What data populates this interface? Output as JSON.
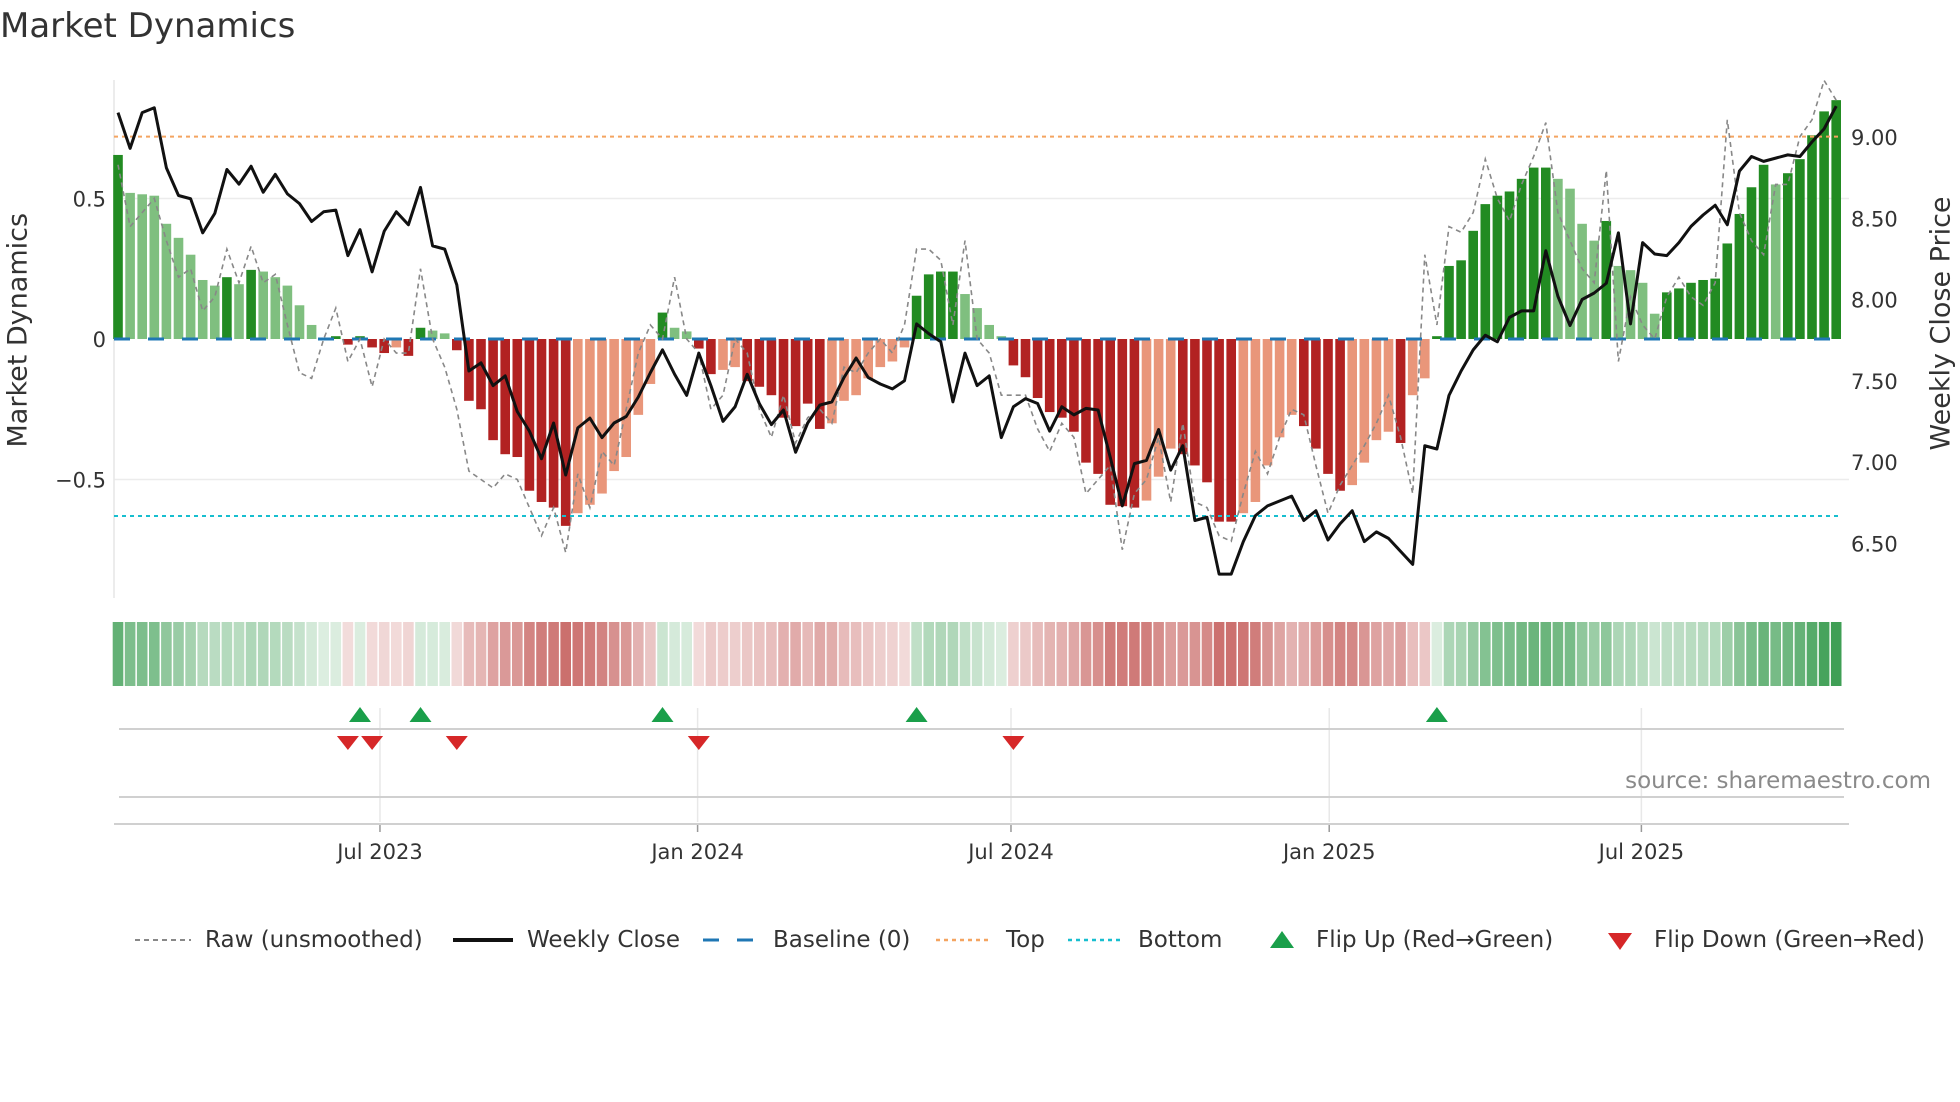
{
  "title": "Market Dynamics",
  "source": "source: sharemaestro.com",
  "chart_data": {
    "type": "bar",
    "title": "Market Dynamics",
    "ylabel": "Market Dynamics",
    "y2label": "Weekly Close Price",
    "ylim": [
      -0.92,
      0.92
    ],
    "y2lim": [
      6.12,
      9.38
    ],
    "yticks": [
      {
        "v": 0.5,
        "label": "0.5"
      },
      {
        "v": 0,
        "label": "0"
      },
      {
        "v": -0.5,
        "label": "−0.5"
      }
    ],
    "y2ticks": [
      {
        "v": 9.0,
        "label": "9.00"
      },
      {
        "v": 8.5,
        "label": "8.50"
      },
      {
        "v": 8.0,
        "label": "8.00"
      },
      {
        "v": 7.5,
        "label": "7.50"
      },
      {
        "v": 7.0,
        "label": "7.00"
      },
      {
        "v": 6.5,
        "label": "6.50"
      }
    ],
    "xticks": [
      {
        "week": 21.65,
        "label": "Jul 2023"
      },
      {
        "week": 47.9,
        "label": "Jan 2024"
      },
      {
        "week": 73.8,
        "label": "Jul 2024"
      },
      {
        "week": 100.1,
        "label": "Jan 2025"
      },
      {
        "week": 125.9,
        "label": "Jul 2025"
      }
    ],
    "grid": true,
    "legend_placement": "bottom",
    "top_level": 0.72,
    "bottom_level": -0.63,
    "baseline": 0,
    "colors": {
      "dark_green": "#228b22",
      "light_green": "#7fbf7f",
      "dark_red": "#b22222",
      "light_red": "#e9967a",
      "raw": "#888888",
      "close": "#111111",
      "baseline": "#1f77b4",
      "top": "#f4a460",
      "bottom": "#17becf",
      "flip_up": "#1a9f4a",
      "flip_down": "#d62728",
      "heat_green": "#3f9f55",
      "heat_red": "#c0504d"
    },
    "momentum": [
      0.655,
      0.52,
      0.515,
      0.51,
      0.41,
      0.36,
      0.3,
      0.21,
      0.19,
      0.22,
      0.195,
      0.246,
      0.24,
      0.22,
      0.19,
      0.12,
      0.05,
      0.005,
      0.01,
      -0.02,
      0.01,
      -0.03,
      -0.05,
      -0.03,
      -0.06,
      0.04,
      0.03,
      0.02,
      -0.04,
      -0.22,
      -0.25,
      -0.36,
      -0.41,
      -0.42,
      -0.54,
      -0.58,
      -0.6,
      -0.665,
      -0.62,
      -0.59,
      -0.55,
      -0.47,
      -0.42,
      -0.27,
      -0.16,
      0.094,
      0.04,
      0.027,
      -0.034,
      -0.125,
      -0.11,
      -0.1,
      -0.15,
      -0.17,
      -0.2,
      -0.28,
      -0.31,
      -0.23,
      -0.32,
      -0.3,
      -0.22,
      -0.2,
      -0.14,
      -0.1,
      -0.08,
      -0.03,
      0.154,
      0.23,
      0.24,
      0.24,
      0.16,
      0.11,
      0.05,
      0.01,
      -0.094,
      -0.136,
      -0.21,
      -0.26,
      -0.28,
      -0.33,
      -0.44,
      -0.48,
      -0.59,
      -0.595,
      -0.6,
      -0.575,
      -0.49,
      -0.39,
      -0.41,
      -0.45,
      -0.51,
      -0.65,
      -0.65,
      -0.62,
      -0.58,
      -0.45,
      -0.35,
      -0.27,
      -0.31,
      -0.39,
      -0.48,
      -0.54,
      -0.52,
      -0.44,
      -0.36,
      -0.33,
      -0.37,
      -0.2,
      -0.14,
      0.01,
      0.26,
      0.28,
      0.385,
      0.48,
      0.51,
      0.525,
      0.57,
      0.61,
      0.61,
      0.57,
      0.535,
      0.41,
      0.35,
      0.42,
      0.26,
      0.245,
      0.2,
      0.09,
      0.166,
      0.18,
      0.2,
      0.21,
      0.215,
      0.34,
      0.445,
      0.54,
      0.62,
      0.55,
      0.59,
      0.64,
      0.725,
      0.81,
      0.85
    ],
    "shade": "DLLLLLLLLDLDLLLLLLDDDDDLDDLLDDDDDDDDDDLLLLLLLDLLDDLLDDDDDDDLLLLLLLDDDDLLLLDDDDDDDDDDDLLLDDDDDLLLLLDDDDLLLLDLLDDDDDDDDDDLLLLDLLLLDDDDDDDDDLDDDDD",
    "raw": [
      0.62,
      0.4,
      0.45,
      0.5,
      0.35,
      0.22,
      0.25,
      0.1,
      0.15,
      0.32,
      0.2,
      0.33,
      0.2,
      0.23,
      0.05,
      -0.12,
      -0.14,
      0.0,
      0.11,
      -0.08,
      0.0,
      -0.17,
      0.0,
      -0.05,
      -0.05,
      0.25,
      0.0,
      -0.1,
      -0.25,
      -0.47,
      -0.5,
      -0.53,
      -0.48,
      -0.5,
      -0.6,
      -0.7,
      -0.6,
      -0.76,
      -0.48,
      -0.6,
      -0.4,
      -0.45,
      -0.25,
      -0.05,
      0.05,
      0.0,
      0.22,
      0.0,
      -0.05,
      -0.25,
      -0.2,
      0.0,
      -0.05,
      -0.25,
      -0.35,
      -0.2,
      -0.37,
      -0.28,
      -0.25,
      -0.3,
      -0.1,
      -0.12,
      -0.05,
      0.0,
      -0.05,
      0.05,
      0.32,
      0.32,
      0.28,
      0.05,
      0.35,
      0.0,
      -0.05,
      -0.2,
      -0.2,
      -0.2,
      -0.32,
      -0.4,
      -0.3,
      -0.35,
      -0.55,
      -0.5,
      -0.45,
      -0.75,
      -0.55,
      -0.5,
      -0.35,
      -0.58,
      -0.3,
      -0.58,
      -0.6,
      -0.7,
      -0.72,
      -0.55,
      -0.4,
      -0.48,
      -0.35,
      -0.25,
      -0.27,
      -0.45,
      -0.62,
      -0.52,
      -0.45,
      -0.38,
      -0.3,
      -0.2,
      -0.35,
      -0.55,
      0.3,
      0.05,
      0.4,
      0.38,
      0.45,
      0.64,
      0.5,
      0.42,
      0.55,
      0.65,
      0.77,
      0.45,
      0.35,
      0.25,
      0.2,
      0.6,
      -0.08,
      0.15,
      0.05,
      0.0,
      0.15,
      0.22,
      0.15,
      0.12,
      0.2,
      0.78,
      0.45,
      0.35,
      0.3,
      0.55,
      0.55,
      0.72,
      0.78,
      0.92,
      0.85
    ],
    "close": [
      9.15,
      8.93,
      9.15,
      9.18,
      8.81,
      8.64,
      8.62,
      8.41,
      8.53,
      8.8,
      8.71,
      8.82,
      8.66,
      8.77,
      8.65,
      8.59,
      8.48,
      8.54,
      8.55,
      8.27,
      8.43,
      8.17,
      8.42,
      8.54,
      8.46,
      8.69,
      8.33,
      8.31,
      8.09,
      7.56,
      7.61,
      7.47,
      7.53,
      7.31,
      7.19,
      7.02,
      7.24,
      6.92,
      7.21,
      7.27,
      7.15,
      7.24,
      7.28,
      7.4,
      7.55,
      7.69,
      7.54,
      7.41,
      7.67,
      7.47,
      7.25,
      7.34,
      7.54,
      7.36,
      7.23,
      7.32,
      7.06,
      7.24,
      7.35,
      7.37,
      7.52,
      7.64,
      7.52,
      7.48,
      7.45,
      7.5,
      7.85,
      7.79,
      7.74,
      7.37,
      7.67,
      7.47,
      7.53,
      7.15,
      7.34,
      7.39,
      7.36,
      7.19,
      7.34,
      7.29,
      7.33,
      7.32,
      7.03,
      6.73,
      6.99,
      7.01,
      7.2,
      6.95,
      7.1,
      6.64,
      6.66,
      6.31,
      6.31,
      6.51,
      6.67,
      6.73,
      6.76,
      6.79,
      6.64,
      6.7,
      6.52,
      6.62,
      6.7,
      6.51,
      6.57,
      6.53,
      6.45,
      6.37,
      7.1,
      7.08,
      7.41,
      7.56,
      7.69,
      7.78,
      7.74,
      7.89,
      7.93,
      7.93,
      8.3,
      8.02,
      7.84,
      8.0,
      8.04,
      8.1,
      8.41,
      7.85,
      8.35,
      8.28,
      8.27,
      8.35,
      8.45,
      8.52,
      8.58,
      8.46,
      8.79,
      8.88,
      8.85,
      8.87,
      8.89,
      8.88,
      8.97,
      9.05,
      9.19
    ],
    "flip_up_weeks": [
      20,
      25,
      45,
      66,
      109
    ],
    "flip_down_weeks": [
      19,
      21,
      28,
      48,
      74
    ],
    "legend": [
      {
        "key": "raw",
        "label": "Raw (unsmoothed)"
      },
      {
        "key": "close",
        "label": "Weekly Close"
      },
      {
        "key": "baseline",
        "label": "Baseline (0)"
      },
      {
        "key": "top",
        "label": "Top"
      },
      {
        "key": "bottom",
        "label": "Bottom"
      },
      {
        "key": "flip_up",
        "label": "Flip Up (Red→Green)"
      },
      {
        "key": "flip_down",
        "label": "Flip Down (Green→Red)"
      }
    ]
  }
}
